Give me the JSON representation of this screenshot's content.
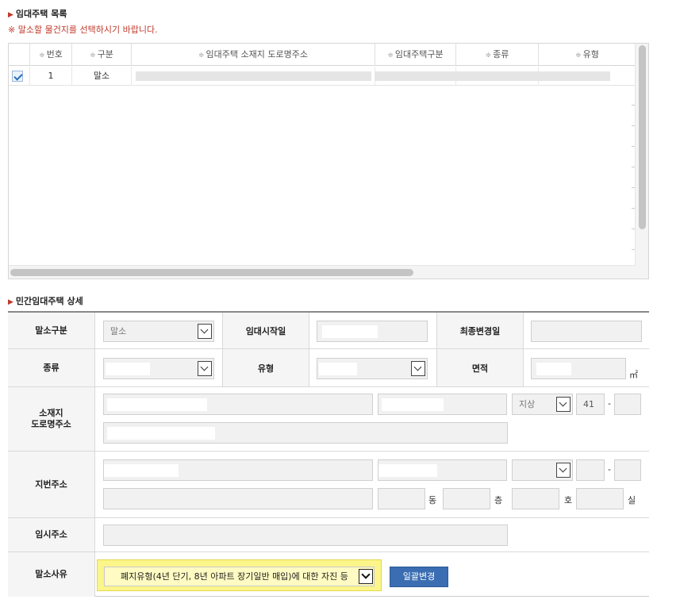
{
  "list_section": {
    "title": "임대주택 목록",
    "notice": "※ 말소할 물건지를 선택하시기 바랍니다.",
    "columns": [
      "번호",
      "구분",
      "임대주택 소재지 도로명주소",
      "임대주택구분",
      "종류",
      "유형"
    ],
    "rows": [
      {
        "no": "1",
        "type": "말소"
      }
    ]
  },
  "detail_section": {
    "title": "민간임대주택 상세",
    "labels": {
      "cancel_type": "말소구분",
      "rental_start": "임대시작일",
      "last_changed": "최종변경일",
      "kind": "종류",
      "category": "유형",
      "area": "면적",
      "road_address": "소재지\n도로명주소",
      "lot_address": "지번주소",
      "temp_address": "임시주소",
      "cancel_reason": "말소사유"
    },
    "values": {
      "cancel_type": "말소",
      "ground": "지상",
      "building_no": "41",
      "hyphen": "-",
      "area_unit": "㎡",
      "dong": "동",
      "floor": "층",
      "ho": "호",
      "room": "실",
      "cancel_reason": "폐지유형(4년 단기, 8년 아파트 장기일반 매입)에 대한 자진 등"
    },
    "apply_button": "일괄변경"
  },
  "colors": {
    "accent": "#3a6db2",
    "notice": "#c0392b",
    "highlight": "#fbf58a"
  }
}
